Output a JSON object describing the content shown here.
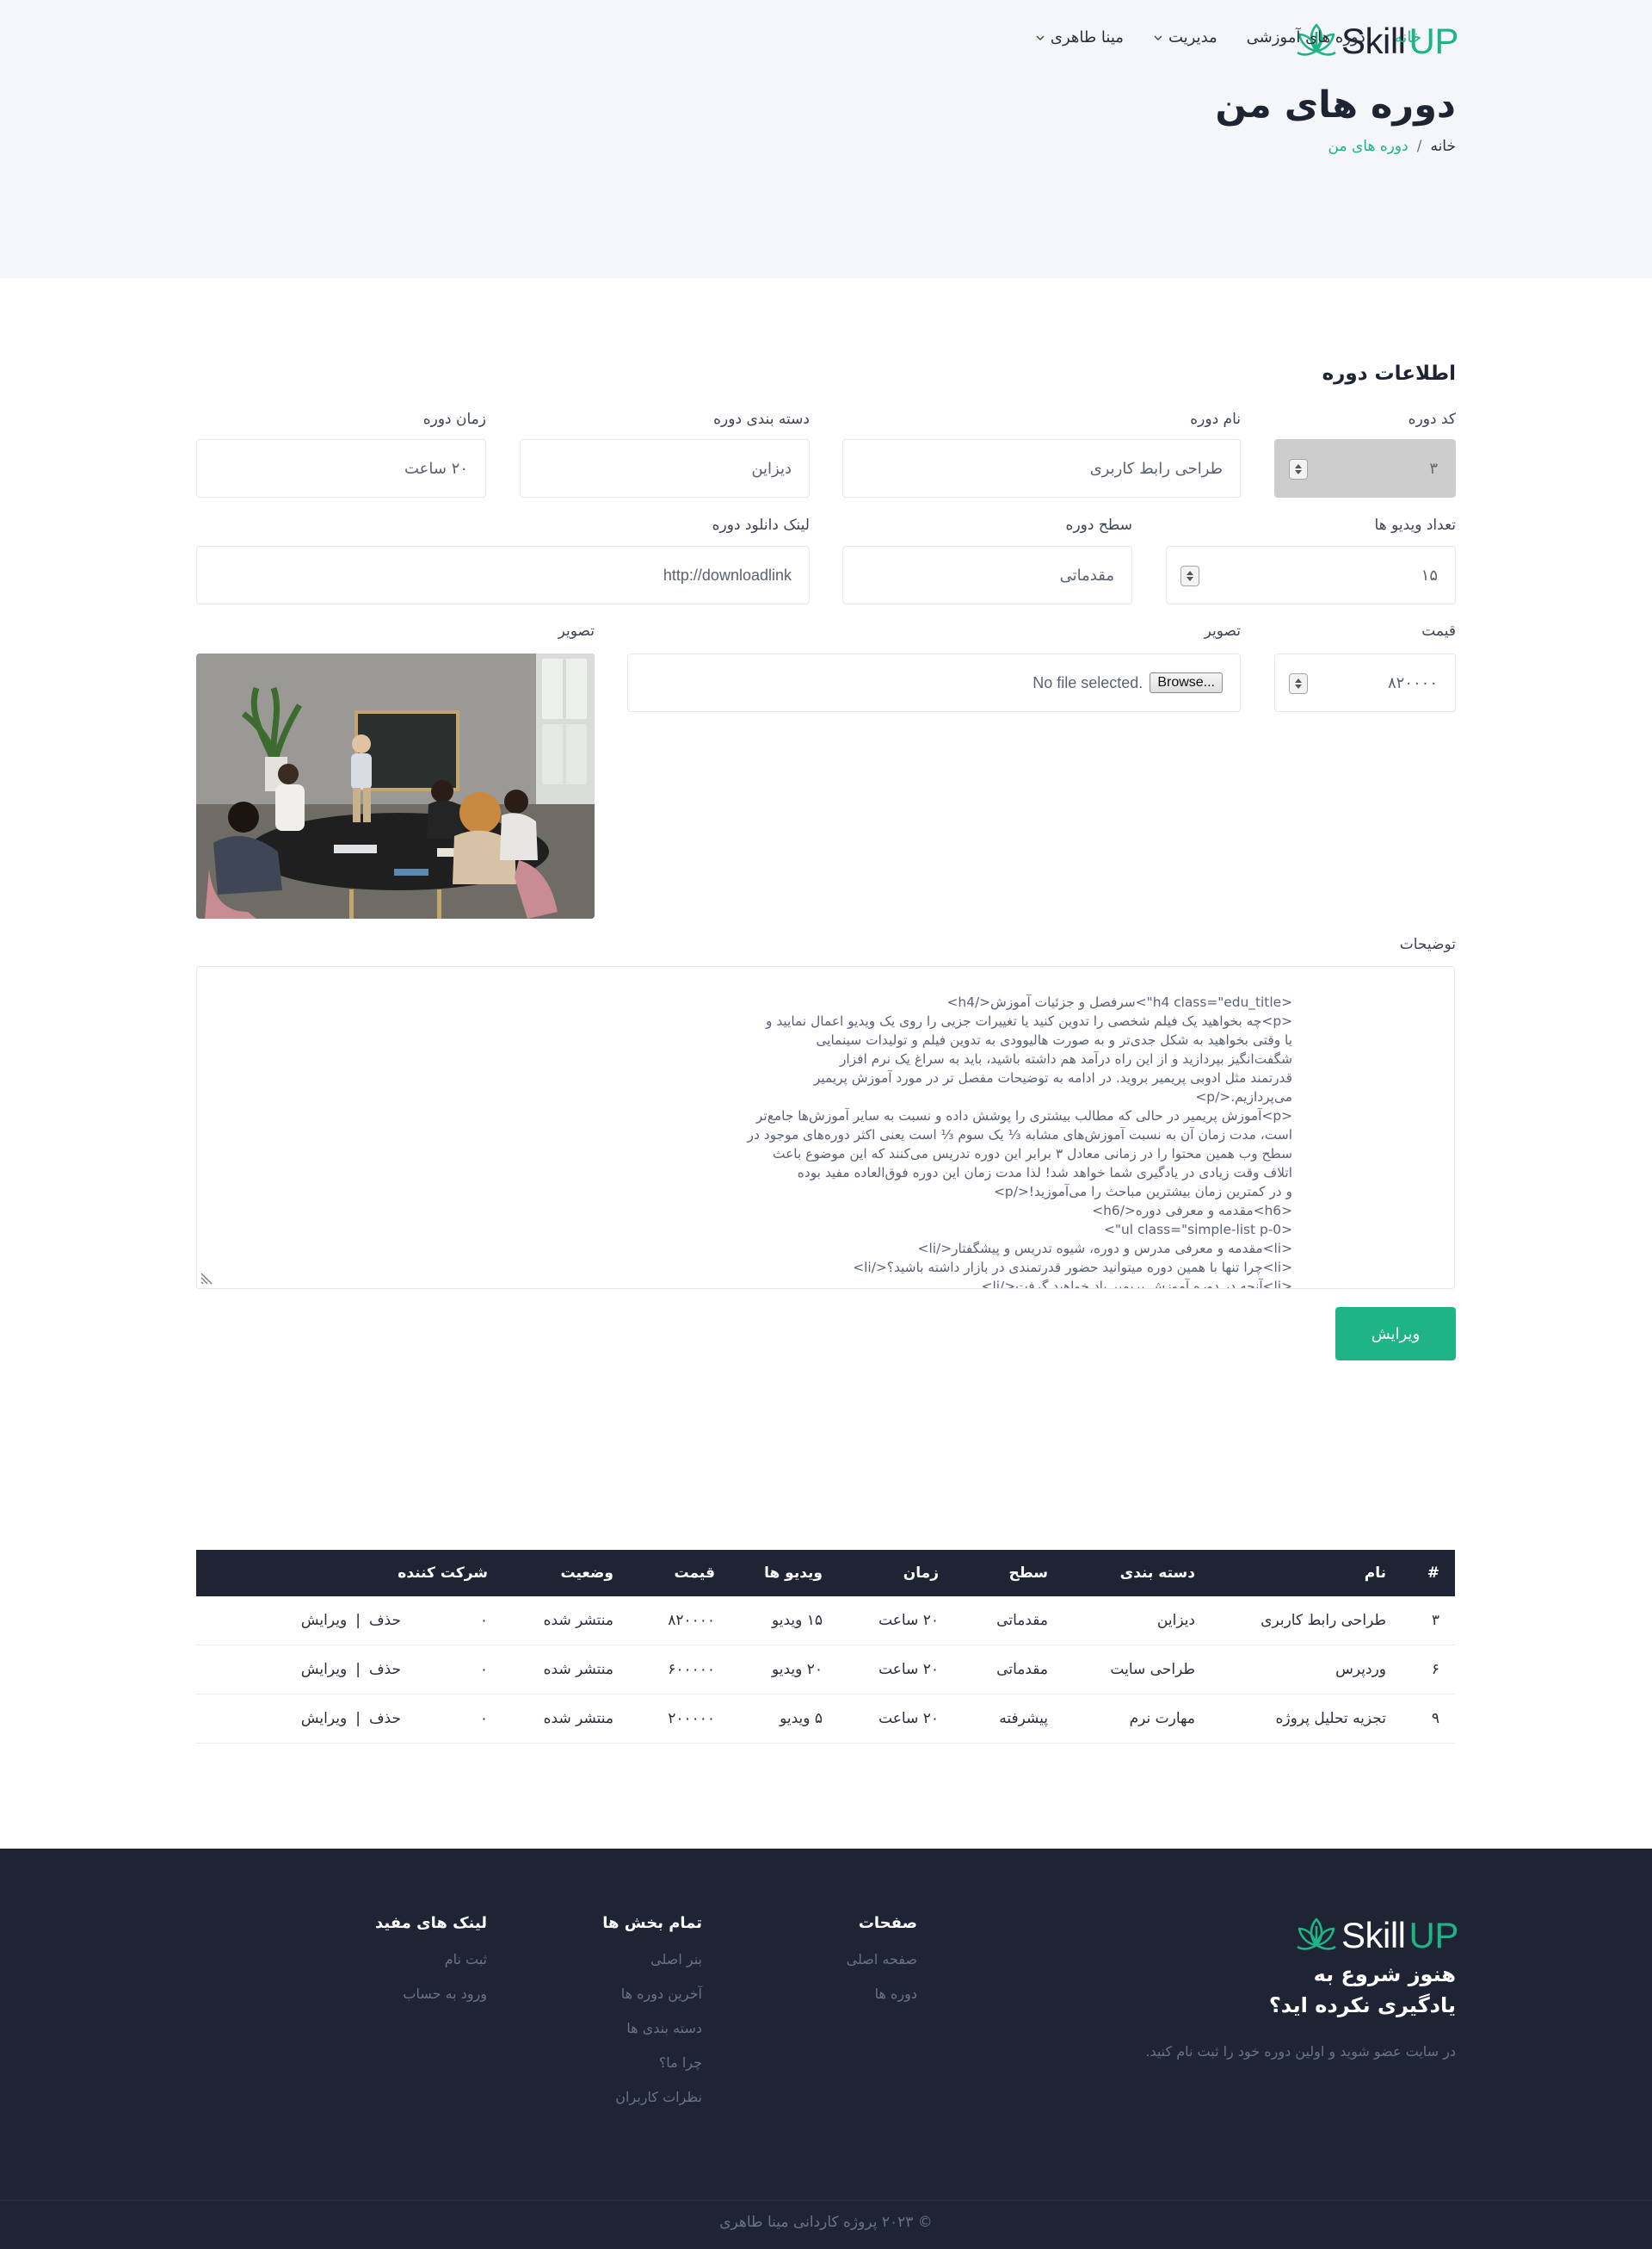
{
  "brand": {
    "name_part1": "Skill",
    "name_part2": "UP"
  },
  "nav": {
    "home": "خانه",
    "courses": "دوره های آموزشی",
    "manage": "مدیریت",
    "user": "مینا طاهری"
  },
  "header": {
    "title": "دوره های من",
    "breadcrumb_home": "خانه",
    "breadcrumb_sep": "/",
    "breadcrumb_current": "دوره های من"
  },
  "form": {
    "section_title": "اطلاعات دوره",
    "code": {
      "label": "کد دوره",
      "value": "۳"
    },
    "name": {
      "label": "نام دوره",
      "value": "طراحی رابط کاربری"
    },
    "category": {
      "label": "دسته بندی دوره",
      "value": "دیزاین"
    },
    "duration": {
      "label": "زمان دوره",
      "value": "۲۰ ساعت"
    },
    "videos": {
      "label": "تعداد ویدیو ها",
      "value": "۱۵"
    },
    "level": {
      "label": "سطح دوره",
      "value": "مقدماتی"
    },
    "download": {
      "label": "لینک دانلود دوره",
      "value": "http://downloadlink"
    },
    "price": {
      "label": "قیمت",
      "value": "۸۲۰۰۰۰"
    },
    "image_input": {
      "label": "تصویر",
      "button": "Browse...",
      "status": "No file selected."
    },
    "image_preview": {
      "label": "تصویر"
    },
    "description": {
      "label": "توضیحات",
      "value": "<h4 class=\"edu_title\">سرفصل و جزئیات آموزش</h4>\n<p>چه بخواهید یک فیلم شخصی را تدوین کنید یا تغییرات جزیی را روی یک ویدیو اعمال نمایید و\nیا وقتی بخواهید به شکل جدی‌تر و به صورت هالیوودی به تدوین فیلم و تولیدات سینمایی\nشگفت‌انگیز بپردازید و از این راه درآمد هم داشته باشید، باید به سراغ یک نرم افزار\nقدرتمند مثل ادوبی پریمیر بروید. در ادامه به توضیحات مفصل تر در مورد آموزش پریمیر\nمی‌پردازیم.</p>\n<p>آموزش پریمیر در حالی که مطالب بیشتری را پوشش داده و نسبت به سایر آموزش‌ها جامع‌تر\nاست، مدت زمان آن به نسبت آموزش‌های مشابه ⅓ یک سوم ⅓ است یعنی اکثر دوره‌های موجود در\nسطح وب همین محتوا را در زمانی معادل ۳ برابر این دوره تدریس می‌کنند که این موضوع باعث\nاتلاف وقت زیادی در یادگیری شما خواهد شد! لذا مدت زمان این دوره فوق‌العاده مفید بوده\nو در کمترین زمان بیشترین مباحث را می‌آموزید!</p>\n<h6>مقدمه و معرفی دوره</h6>\n<ul class=\"simple-list p-0\">\n<li>مقدمه و معرفی مدرس و دوره، شیوه تدریس و پیشگفتار</li>\n<li>چرا تنها با همین دوره میتوانید حضور قدرتمندی در بازار داشته باشید؟</li>\n<li>آنچه در دوره آموزش پریمیر یاد خواهید گرفت</li>"
    },
    "submit": "ویرایش"
  },
  "table": {
    "headers": [
      "#",
      "نام",
      "دسته بندی",
      "سطح",
      "زمان",
      "ویدیو ها",
      "قیمت",
      "وضعیت",
      "شرکت کننده"
    ],
    "rows": [
      {
        "id": "۳",
        "name": "طراحی رابط کاربری",
        "category": "دیزاین",
        "level": "مقدماتی",
        "time": "۲۰ ساعت",
        "videos": "۱۵ ویدیو",
        "price": "۸۲۰۰۰۰",
        "status": "منتشر شده",
        "participants": "۰"
      },
      {
        "id": "۶",
        "name": "وردپرس",
        "category": "طراحی سایت",
        "level": "مقدماتی",
        "time": "۲۰ ساعت",
        "videos": "۲۰ ویدیو",
        "price": "۶۰۰۰۰۰",
        "status": "منتشر شده",
        "participants": "۰"
      },
      {
        "id": "۹",
        "name": "تجزیه تحلیل پروژه",
        "category": "مهارت نرم",
        "level": "پیشرفته",
        "time": "۲۰ ساعت",
        "videos": "۵ ویدیو",
        "price": "۲۰۰۰۰۰",
        "status": "منتشر شده",
        "participants": "۰"
      }
    ],
    "delete_label": "حذف",
    "edit_label": "ویرایش",
    "action_sep": "|"
  },
  "footer": {
    "tagline": "هنوز شروع به یادگیری نکرده اید؟",
    "desc": "در سایت عضو شوید و اولین دوره خود را ثبت نام کنید.",
    "col_pages": {
      "title": "صفحات",
      "links": [
        "صفحه اصلی",
        "دوره ها"
      ]
    },
    "col_sections": {
      "title": "تمام بخش ها",
      "links": [
        "بنر اصلی",
        "آخرین دوره ها",
        "دسته بندی ها",
        "چرا ما؟",
        "نظرات کاربران"
      ]
    },
    "col_useful": {
      "title": "لینک های مفید",
      "links": [
        "ثبت نام",
        "ورود به حساب"
      ]
    },
    "copyright": "© ۲۰۲۳ پروژه کاردانی مینا طاهری"
  },
  "colors": {
    "accent": "#1fb486",
    "dark": "#1e2433",
    "hero_bg": "#f5f6f9"
  },
  "icons": [
    "leaf-logo-icon",
    "chevron-down-icon",
    "spinner-arrows-icon",
    "resize-grip-icon"
  ]
}
